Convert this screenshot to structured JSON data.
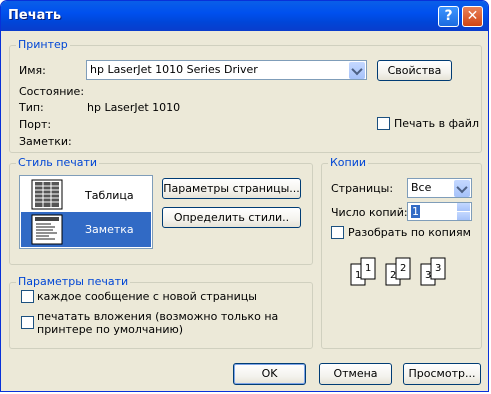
{
  "window": {
    "title": "Печать"
  },
  "printer_group": {
    "label": "Принтер",
    "name_label": "Имя:",
    "name_value": "hp LaserJet 1010 Series Driver",
    "properties_button": "Свойства",
    "status_label": "Состояние:",
    "status_value": "",
    "type_label": "Тип:",
    "type_value": "hp LaserJet 1010",
    "port_label": "Порт:",
    "port_value": "",
    "comment_label": "Заметки:",
    "comment_value": "",
    "print_to_file_label": "Печать в файл",
    "print_to_file_checked": false
  },
  "print_style_group": {
    "label": "Стиль печати",
    "styles": [
      {
        "label": "Таблица",
        "selected": false
      },
      {
        "label": "Заметка",
        "selected": true
      }
    ],
    "page_setup_button": "Параметры страницы...",
    "define_styles_button": "Определить стили.."
  },
  "copies_group": {
    "label": "Копии",
    "pages_label": "Страницы:",
    "pages_value": "Все",
    "copies_label": "Число копий:",
    "copies_value": "1",
    "collate_label": "Разобрать по копиям",
    "collate_checked": false,
    "collate_numbers": [
      "1",
      "1",
      "2",
      "2",
      "3",
      "3"
    ]
  },
  "print_options_group": {
    "label": "Параметры печати",
    "options": [
      {
        "label": "каждое сообщение с новой страницы",
        "checked": false
      },
      {
        "label": "печатать вложения (возможно только на",
        "label2": "принтере по умолчанию)",
        "checked": false
      }
    ]
  },
  "buttons": {
    "ok": "OK",
    "cancel": "Отмена",
    "preview": "Просмотр..."
  },
  "colors": {
    "accent": "#0046d5",
    "selection": "#316ac5",
    "face": "#ece9d8"
  }
}
